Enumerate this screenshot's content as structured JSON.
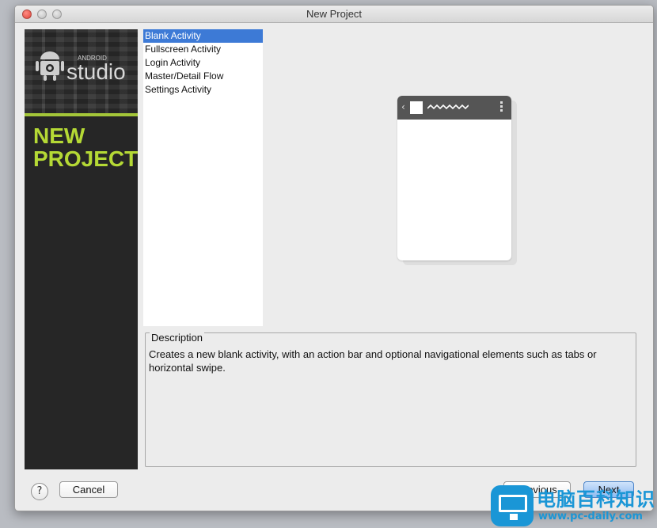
{
  "window": {
    "title": "New Project"
  },
  "brand": {
    "small_label": "ANDROID",
    "big_label": "studio",
    "heading_line1": "NEW",
    "heading_line2": "PROJECT",
    "accent_color": "#a4c639",
    "heading_color": "#b5d935"
  },
  "activities": [
    {
      "label": "Blank Activity",
      "selected": true
    },
    {
      "label": "Fullscreen Activity",
      "selected": false
    },
    {
      "label": "Login Activity",
      "selected": false
    },
    {
      "label": "Master/Detail Flow",
      "selected": false
    },
    {
      "label": "Settings Activity",
      "selected": false
    }
  ],
  "preview": {
    "icon": "phone-preview-actionbar"
  },
  "description": {
    "legend": "Description",
    "text": "Creates a new blank activity, with an action bar and optional navigational elements such as tabs or horizontal swipe."
  },
  "buttons": {
    "help": "?",
    "cancel": "Cancel",
    "previous": "Previous",
    "next": "Next"
  },
  "watermark": {
    "title": "电脑百科知识",
    "url": "www.pc-daily.com",
    "color": "#1a96d6"
  }
}
